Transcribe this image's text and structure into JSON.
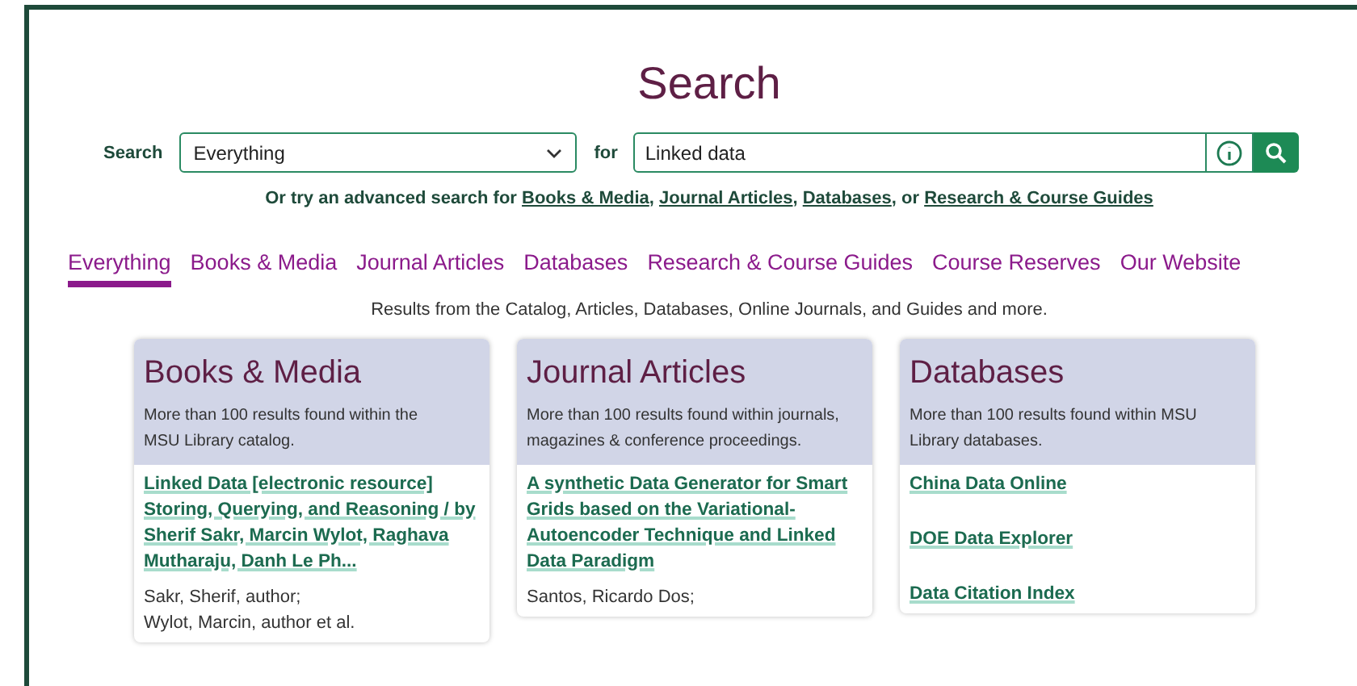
{
  "title": "Search",
  "search": {
    "label": "Search",
    "scope": "Everything",
    "for_label": "for",
    "query": "Linked data"
  },
  "advanced": [
    {
      "text": "Or try an advanced search for ",
      "link": false
    },
    {
      "text": "Books & Media",
      "link": true
    },
    {
      "text": ", ",
      "link": false
    },
    {
      "text": "Journal Articles",
      "link": true
    },
    {
      "text": ", ",
      "link": false
    },
    {
      "text": "Databases",
      "link": true
    },
    {
      "text": ", or ",
      "link": false
    },
    {
      "text": "Research & Course Guides",
      "link": true
    }
  ],
  "tabs": [
    {
      "label": "Everything",
      "selected": true
    },
    {
      "label": "Books & Media",
      "selected": false
    },
    {
      "label": "Journal Articles",
      "selected": false
    },
    {
      "label": "Databases",
      "selected": false
    },
    {
      "label": "Research & Course Guides",
      "selected": false
    },
    {
      "label": "Course Reserves",
      "selected": false
    },
    {
      "label": "Our Website",
      "selected": false
    }
  ],
  "description": "Results from the Catalog, Articles, Databases, Online Journals, and Guides and more.",
  "cards": [
    {
      "title": "Books & Media",
      "summary": "More than 100 results found within the MSU Library catalog.",
      "results": [
        {
          "title": "Linked Data [electronic resource] Storing, Querying, and Reasoning / by Sherif Sakr, Marcin Wylot, Raghava Mutharaju, Danh Le Ph...",
          "authors": [
            "Sakr, Sherif, author;",
            "Wylot, Marcin, author et al."
          ]
        }
      ]
    },
    {
      "title": "Journal Articles",
      "summary": "More than 100 results found within journals, magazines & conference proceedings.",
      "results": [
        {
          "title": "A synthetic Data Generator for Smart Grids based on the Variational-Autoencoder Technique and Linked Data Paradigm",
          "authors": [
            "Santos, Ricardo Dos;"
          ]
        }
      ]
    },
    {
      "title": "Databases",
      "summary": "More than 100 results found within MSU Library databases.",
      "results": [
        {
          "title": "China Data Online"
        },
        {
          "title": "DOE Data Explorer"
        },
        {
          "title": "Data Citation Index"
        }
      ]
    }
  ]
}
